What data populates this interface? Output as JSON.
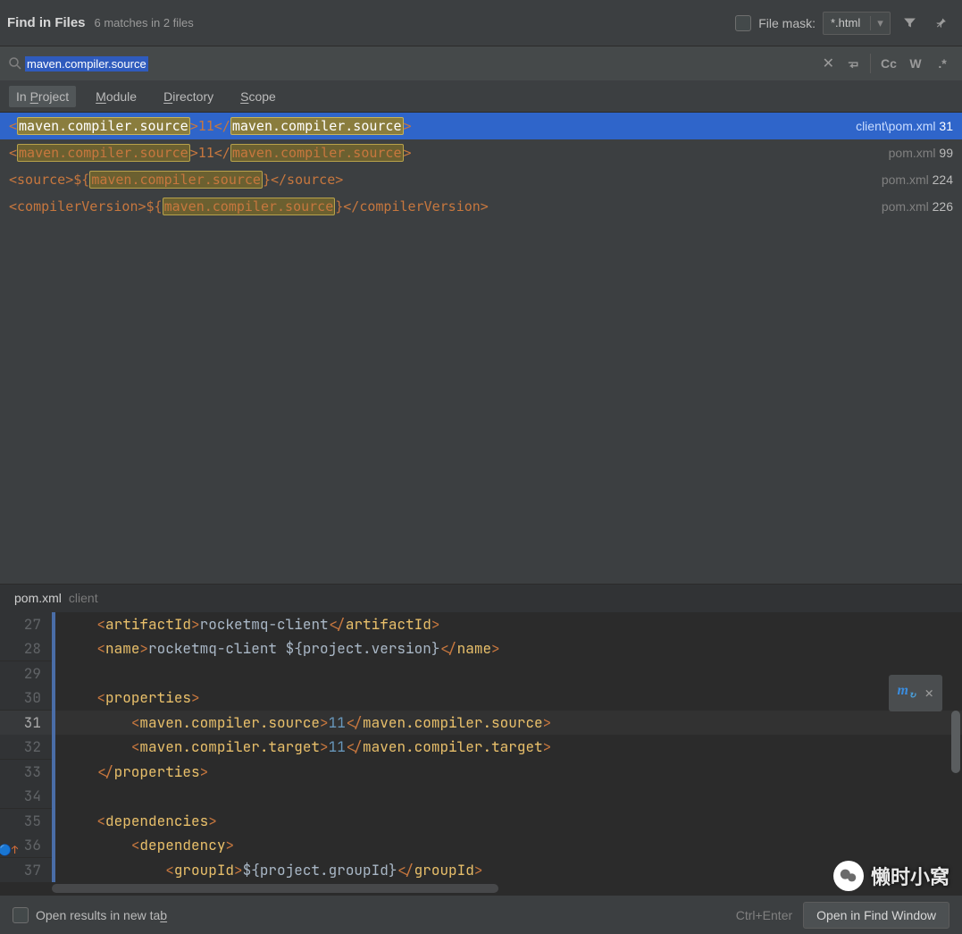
{
  "header": {
    "title": "Find in Files",
    "subtitle": "6 matches in 2 files",
    "file_mask_label": "File mask:",
    "file_mask_value": "*.html"
  },
  "search": {
    "value": "maven.compiler.source",
    "cc": "Cc",
    "w": "W",
    "regex": ".*"
  },
  "scope": {
    "in_project": "In Project",
    "module": "Module",
    "directory": "Directory",
    "scope_tab": "Scope"
  },
  "results": [
    {
      "segments": [
        {
          "t": "<",
          "cls": "txt-orange"
        },
        {
          "t": "maven.compiler.source",
          "cls": "match-hl"
        },
        {
          "t": ">11</",
          "cls": "txt-orange"
        },
        {
          "t": "maven.compiler.source",
          "cls": "match-hl"
        },
        {
          "t": ">",
          "cls": "txt-orange"
        }
      ],
      "file": "client\\pom.xml",
      "line": "31",
      "selected": true
    },
    {
      "segments": [
        {
          "t": "<",
          "cls": "txt-orange"
        },
        {
          "t": "maven.compiler.source",
          "cls": "match-hl"
        },
        {
          "t": ">11</",
          "cls": "txt-orange"
        },
        {
          "t": "maven.compiler.source",
          "cls": "match-hl"
        },
        {
          "t": ">",
          "cls": "txt-orange"
        }
      ],
      "file": "pom.xml",
      "line": "99",
      "selected": false
    },
    {
      "segments": [
        {
          "t": "<source>${",
          "cls": "txt-orange"
        },
        {
          "t": "maven.compiler.source",
          "cls": "match-hl"
        },
        {
          "t": "}</source>",
          "cls": "txt-orange"
        }
      ],
      "file": "pom.xml",
      "line": "224",
      "selected": false
    },
    {
      "segments": [
        {
          "t": "<compilerVersion>${",
          "cls": "txt-orange"
        },
        {
          "t": "maven.compiler.source",
          "cls": "match-hl"
        },
        {
          "t": "}</compilerVersion>",
          "cls": "txt-orange"
        }
      ],
      "file": "pom.xml",
      "line": "226",
      "selected": false
    }
  ],
  "preview": {
    "file": "pom.xml",
    "context": "client",
    "lines": [
      {
        "n": "27",
        "html": "    <span class='tag-br'>&lt;</span><span class='tag-name'>artifactId</span><span class='tag-br'>&gt;</span><span class='tag-text'>rocketmq-client</span><span class='tag-br'>&lt;/</span><span class='tag-name'>artifactId</span><span class='tag-br'>&gt;</span>"
      },
      {
        "n": "28",
        "html": "    <span class='tag-br'>&lt;</span><span class='tag-name'>name</span><span class='tag-br'>&gt;</span><span class='tag-text'>rocketmq-client ${project.version}</span><span class='tag-br'>&lt;/</span><span class='tag-name'>name</span><span class='tag-br'>&gt;</span>"
      },
      {
        "n": "29",
        "html": ""
      },
      {
        "n": "30",
        "html": "    <span class='tag-br'>&lt;</span><span class='tag-name'>properties</span><span class='tag-br'>&gt;</span>"
      },
      {
        "n": "31",
        "html": "        <span class='tag-br'>&lt;</span><span class='tag-name'>maven.compiler.source</span><span class='tag-br'>&gt;</span><span class='tag-num'>11</span><span class='tag-br'>&lt;/</span><span class='tag-name'>maven.compiler.source</span><span class='tag-br'>&gt;</span>",
        "hl": true
      },
      {
        "n": "32",
        "html": "        <span class='tag-br'>&lt;</span><span class='tag-name'>maven.compiler.target</span><span class='tag-br'>&gt;</span><span class='tag-num'>11</span><span class='tag-br'>&lt;/</span><span class='tag-name'>maven.compiler.target</span><span class='tag-br'>&gt;</span>"
      },
      {
        "n": "33",
        "html": "    <span class='tag-br'>&lt;/</span><span class='tag-name'>properties</span><span class='tag-br'>&gt;</span>"
      },
      {
        "n": "34",
        "html": ""
      },
      {
        "n": "35",
        "html": "    <span class='tag-br'>&lt;</span><span class='tag-name'>dependencies</span><span class='tag-br'>&gt;</span>"
      },
      {
        "n": "36",
        "html": "        <span class='tag-br'>&lt;</span><span class='tag-name'>dependency</span><span class='tag-br'>&gt;</span>",
        "gutter_icon": true
      },
      {
        "n": "37",
        "html": "            <span class='tag-br'>&lt;</span><span class='tag-name'>groupId</span><span class='tag-br'>&gt;</span><span class='tag-text'>${project.groupId}</span><span class='tag-br'>&lt;/</span><span class='tag-name'>groupId</span><span class='tag-br'>&gt;</span>"
      }
    ]
  },
  "bottom": {
    "open_new_tab": "Open results in new tab",
    "shortcut": "Ctrl+Enter",
    "open_window": "Open in Find Window"
  },
  "watermark": "懒时小窝"
}
